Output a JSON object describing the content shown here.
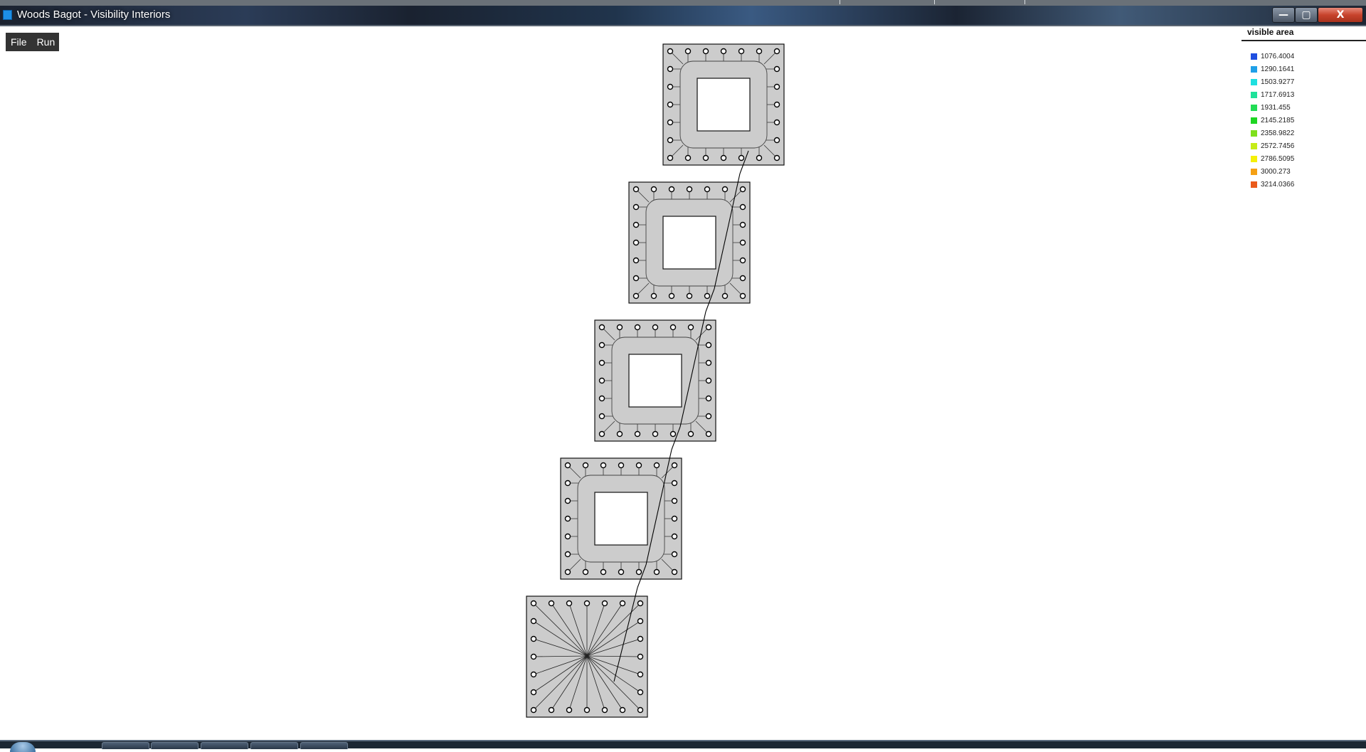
{
  "window": {
    "title": "Woods Bagot - Visibility Interiors",
    "controls": {
      "minimize": "—",
      "maximize": "▢",
      "close": "X"
    }
  },
  "menu": {
    "file": "File",
    "run": "Run"
  },
  "legend": {
    "title": "visible area",
    "items": [
      {
        "label": "1076.4004",
        "color": "#1f4fe0"
      },
      {
        "label": "1290.1641",
        "color": "#1fa0e8"
      },
      {
        "label": "1503.9277",
        "color": "#1ee0e0"
      },
      {
        "label": "1717.6913",
        "color": "#1fe29a"
      },
      {
        "label": "1931.455",
        "color": "#22dd55"
      },
      {
        "label": "2145.2185",
        "color": "#1ed622"
      },
      {
        "label": "2358.9822",
        "color": "#7fe01c"
      },
      {
        "label": "2572.7456",
        "color": "#c6ec18"
      },
      {
        "label": "2786.5095",
        "color": "#f5f007"
      },
      {
        "label": "3000.273",
        "color": "#f5a014"
      },
      {
        "label": "3214.0366",
        "color": "#ea5a1a"
      }
    ]
  },
  "colors": {
    "floor": "#cccccc",
    "outline": "#111111",
    "void": "#ffffff"
  },
  "floors": [
    {
      "type": "ring"
    },
    {
      "type": "ring"
    },
    {
      "type": "ring"
    },
    {
      "type": "ring"
    },
    {
      "type": "radial"
    }
  ]
}
